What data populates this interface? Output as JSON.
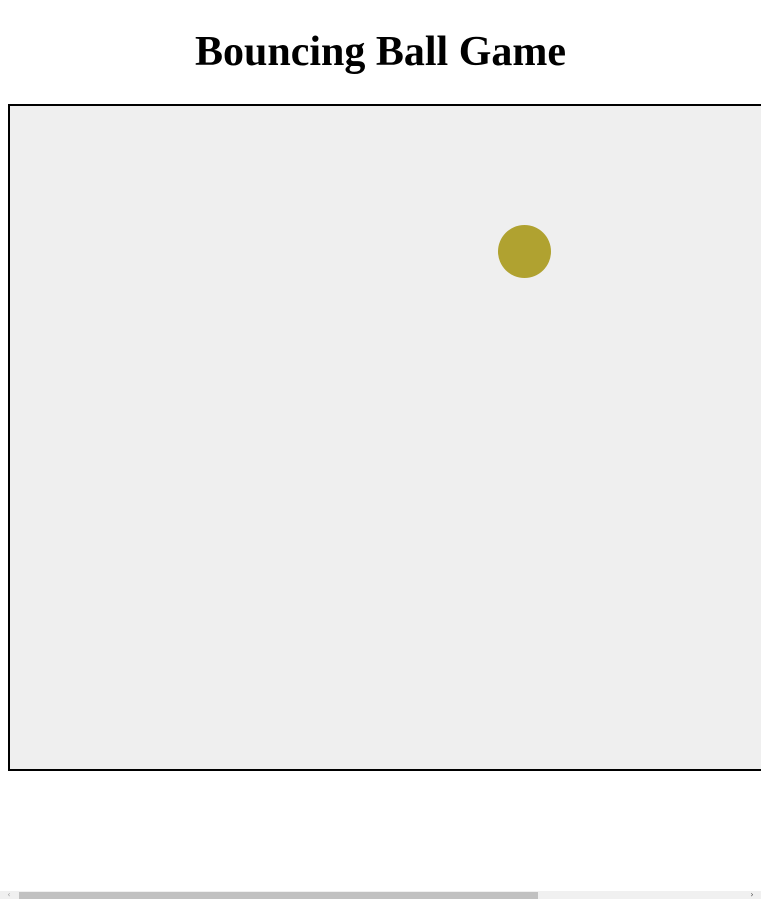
{
  "page": {
    "title": "Bouncing Ball Game"
  },
  "game": {
    "background_color": "#efefef",
    "border_color": "#000000",
    "ball": {
      "color": "#b0a230"
    }
  },
  "scrollbar": {
    "left_arrow_icon": "chevron-left-icon",
    "right_arrow_icon": "chevron-right-icon"
  }
}
